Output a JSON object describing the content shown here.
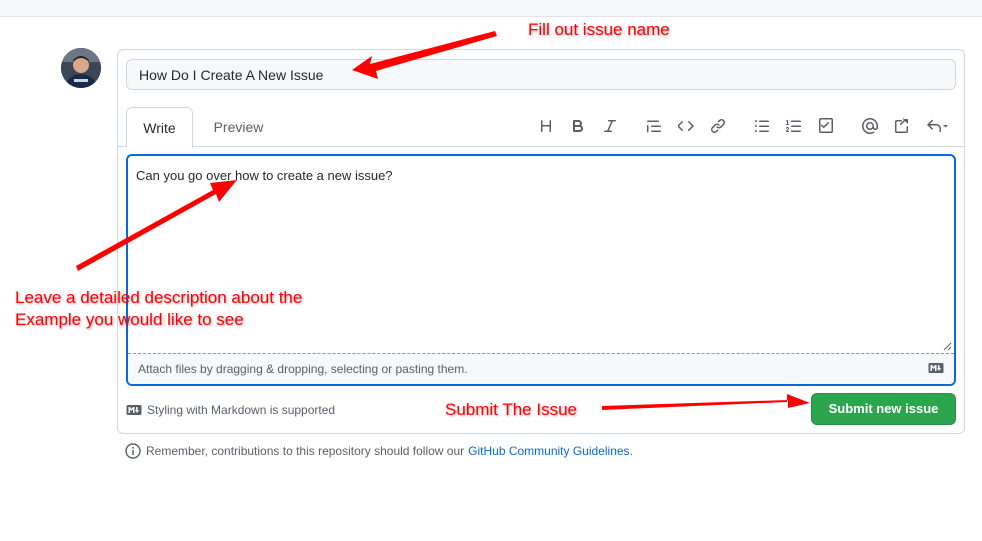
{
  "issue": {
    "title_value": "How Do I Create A New Issue",
    "body_value": "Can you go over how to create a new issue?"
  },
  "tabs": [
    {
      "label": "Write"
    },
    {
      "label": "Preview"
    }
  ],
  "toolbar_icons": [
    "heading-icon",
    "bold-icon",
    "italic-icon",
    "quote-icon",
    "code-icon",
    "link-icon",
    "unordered-list-icon",
    "ordered-list-icon",
    "task-list-icon",
    "mention-icon",
    "reference-icon",
    "reply-icon"
  ],
  "editor_footer": {
    "attach_text": "Attach files by dragging & dropping, selecting or pasting them."
  },
  "markdown_note": "Styling with Markdown is supported",
  "submit_label": "Submit new issue",
  "guidelines": {
    "prefix": "Remember, contributions to this repository should follow our",
    "link": "GitHub Community Guidelines",
    "suffix": "."
  },
  "annotations": {
    "fill_name": "Fill out issue name",
    "description_line1": "Leave a detailed description about the",
    "description_line2": "Example you would like to see",
    "submit": "Submit The Issue"
  },
  "colors": {
    "submit_green": "#2da44e",
    "focus_blue": "#0969da",
    "annotation_red": "#ff0000"
  }
}
